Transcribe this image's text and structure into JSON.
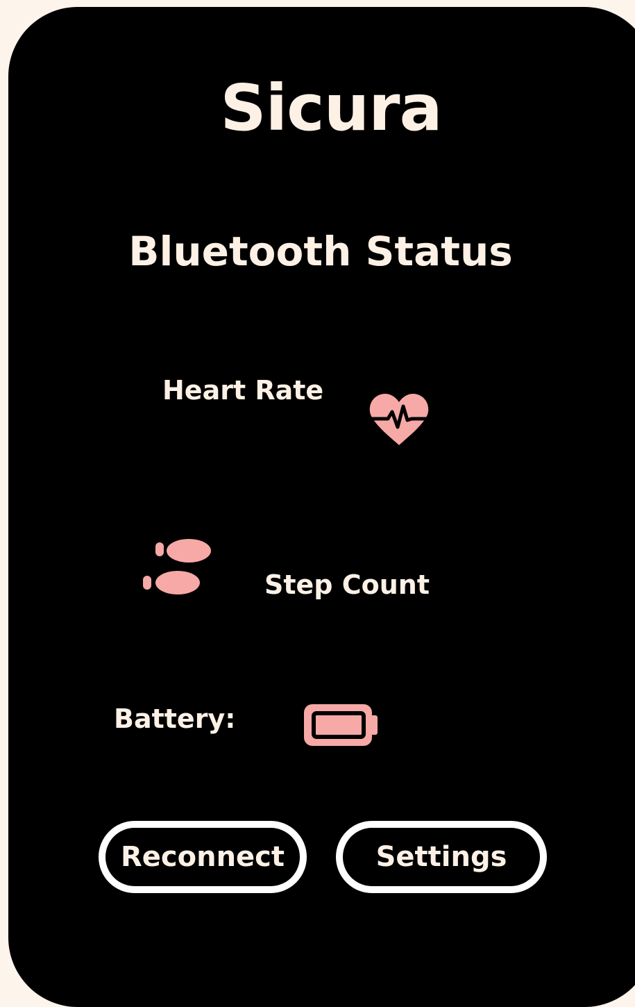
{
  "app": {
    "title": "Sicura"
  },
  "status": {
    "heading": "Bluetooth Status"
  },
  "metrics": {
    "heart_rate_label": "Heart Rate",
    "heart_icon": "heart-pulse-icon",
    "step_count_label": "Step Count",
    "steps_icon": "footsteps-icon",
    "battery_label": "Battery:",
    "battery_icon": "battery-icon"
  },
  "buttons": {
    "reconnect_label": "Reconnect",
    "settings_label": "Settings"
  },
  "colors": {
    "background": "#000000",
    "page": "#fdf4ec",
    "text": "#fdf1e6",
    "icon_accent": "#f6a9a6",
    "button_border": "#ffffff"
  }
}
